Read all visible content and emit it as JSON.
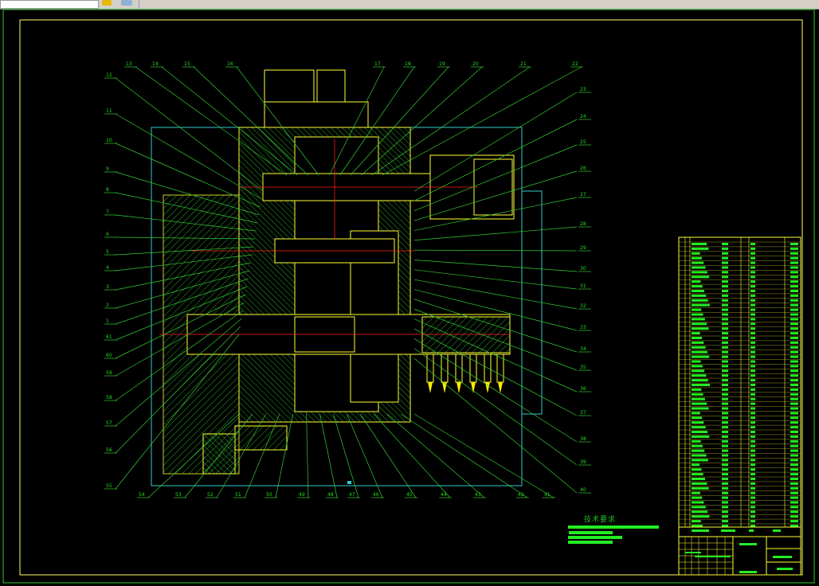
{
  "app": {
    "toolbar": {
      "icons": [
        "layer-icon",
        "layers-stack-icon"
      ]
    }
  },
  "colors": {
    "background": "#000000",
    "frame": "#ffff66",
    "outline": "#ffff33",
    "leader": "#33cc33",
    "hatch": "#2aa02a",
    "centerline": "#ff2020",
    "boundary": "#33cccc",
    "text": "#20e020"
  },
  "drawing": {
    "technical_requirements_title": "技术要求",
    "labels": {
      "left": [
        "12",
        "11",
        "10",
        "9",
        "8",
        "7",
        "6",
        "5",
        "4",
        "3",
        "2",
        "1",
        "61",
        "60",
        "59",
        "58",
        "57",
        "56",
        "55"
      ],
      "top": [
        "13",
        "14",
        "15",
        "16",
        "17",
        "18",
        "19",
        "20",
        "21",
        "22"
      ],
      "right": [
        "23",
        "24",
        "25",
        "26",
        "27",
        "28",
        "29",
        "30",
        "31",
        "32",
        "33",
        "34",
        "35",
        "36",
        "37",
        "38",
        "39",
        "40"
      ],
      "bottom": [
        "54",
        "53",
        "52",
        "51",
        "50",
        "49",
        "48",
        "47",
        "46",
        "45",
        "44",
        "43",
        "42",
        "41"
      ]
    }
  }
}
